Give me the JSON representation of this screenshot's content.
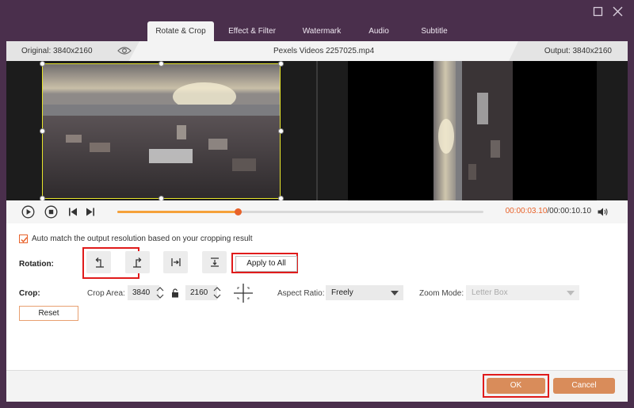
{
  "window": {
    "maximize_icon": "maximize-icon",
    "close_icon": "close-icon"
  },
  "tabs": [
    {
      "label": "Rotate & Crop",
      "active": true
    },
    {
      "label": "Effect & Filter",
      "active": false
    },
    {
      "label": "Watermark",
      "active": false
    },
    {
      "label": "Audio",
      "active": false
    },
    {
      "label": "Subtitle",
      "active": false
    }
  ],
  "info": {
    "original": "Original: 3840x2160",
    "filename": "Pexels Videos 2257025.mp4",
    "output": "Output: 3840x2160"
  },
  "player": {
    "current_time": "00:00:03.10",
    "separator": "/",
    "total_time": "00:00:10.10",
    "progress": 0.33
  },
  "auto_match": {
    "checked": true,
    "label": "Auto match the output resolution based on your cropping result"
  },
  "rotation": {
    "label": "Rotation:",
    "apply_all": "Apply to All"
  },
  "crop": {
    "label": "Crop:",
    "area_label": "Crop Area:",
    "width": "3840",
    "height": "2160",
    "aspect_label": "Aspect Ratio:",
    "aspect_value": "Freely",
    "zoom_label": "Zoom Mode:",
    "zoom_value": "Letter Box",
    "reset": "Reset"
  },
  "footer": {
    "ok": "OK",
    "cancel": "Cancel"
  },
  "colors": {
    "accent": "#e8622a",
    "highlight": "#e01b1b",
    "crop_frame": "#e7e52b",
    "window_bg": "#4a2f4c"
  }
}
